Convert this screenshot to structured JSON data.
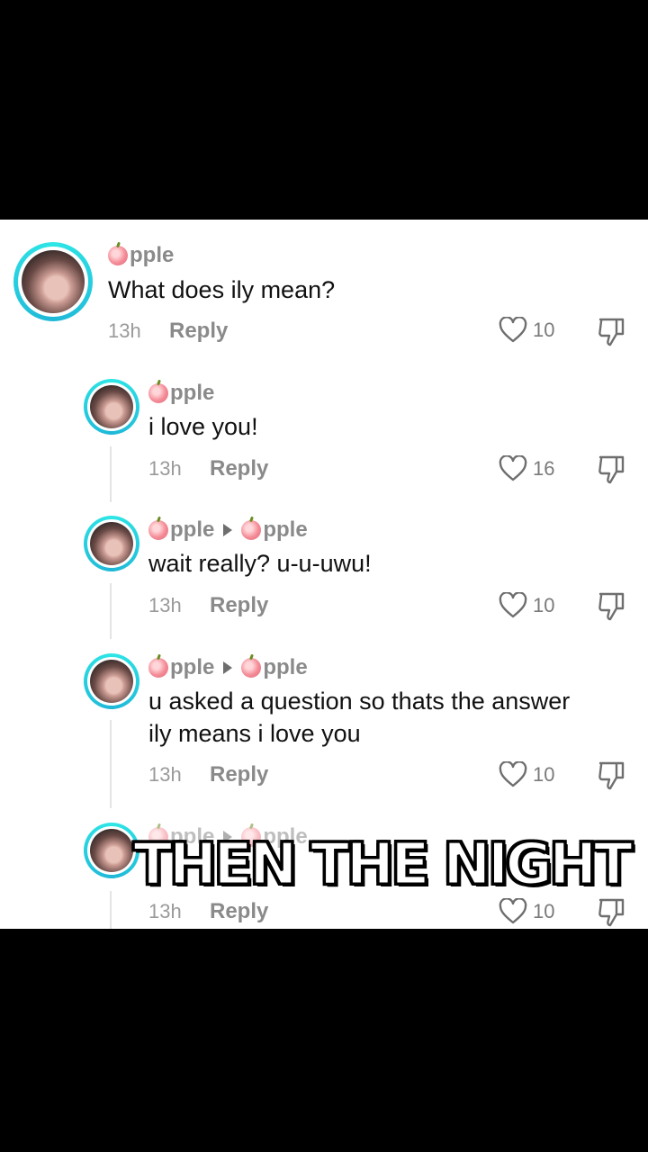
{
  "comments": [
    {
      "username": "pple",
      "text": "What does ily mean?",
      "time": "13h",
      "reply": "Reply",
      "likes": "10"
    },
    {
      "username": "pple",
      "text": "i love you!",
      "time": "13h",
      "reply": "Reply",
      "likes": "16"
    },
    {
      "username": "pple",
      "reply_to": "pple",
      "text": "wait really? u-u-uwu!",
      "time": "13h",
      "reply": "Reply",
      "likes": "10"
    },
    {
      "username": "pple",
      "reply_to": "pple",
      "text": "u asked a question so thats the answer\nily means i love you",
      "time": "13h",
      "reply": "Reply",
      "likes": "10"
    },
    {
      "username": "pple",
      "reply_to": "pple",
      "time": "13h",
      "reply": "Reply",
      "likes": "10"
    }
  ],
  "caption": "THEN THE NIGHT",
  "colors": {
    "avatar_ring": "#2ee6e6",
    "muted": "#8a8a8a"
  }
}
